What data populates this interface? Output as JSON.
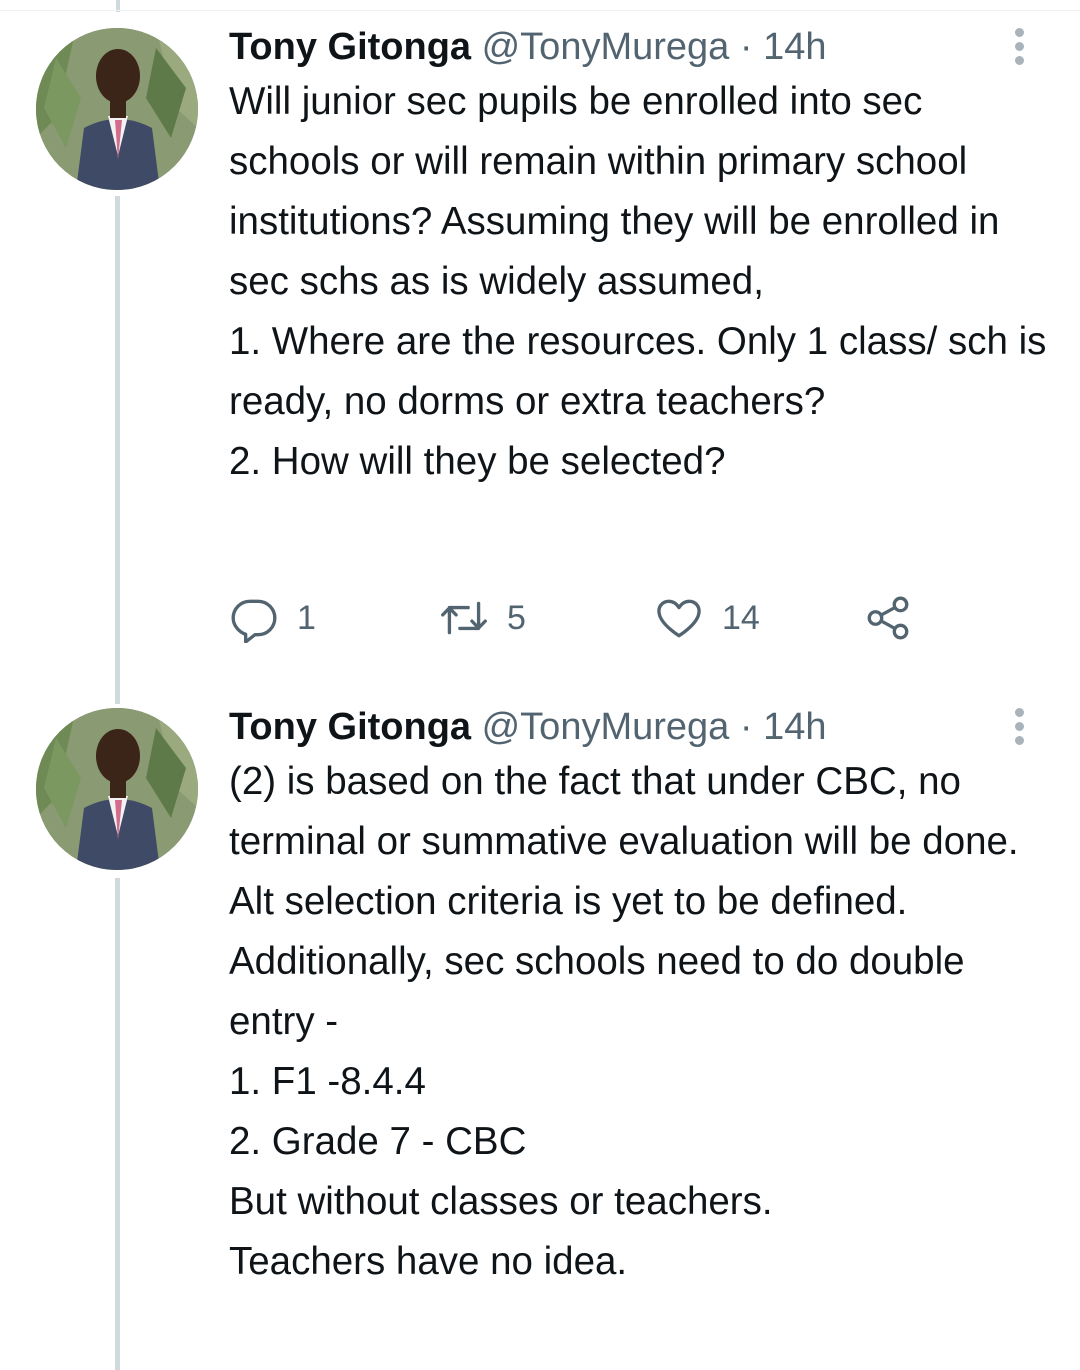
{
  "tweets": [
    {
      "author_name": "Tony Gitonga",
      "handle": "@TonyMurega",
      "separator": "·",
      "time": "14h",
      "text": "Will junior sec pupils be enrolled into sec schools or will remain within primary school institutions? Assuming they will be enrolled in sec schs as is widely assumed,\n1. Where are the resources. Only 1 class/ sch is ready, no dorms or extra teachers?\n2. How will they be selected?",
      "replies": "1",
      "retweets": "5",
      "likes": "14"
    },
    {
      "author_name": "Tony Gitonga",
      "handle": "@TonyMurega",
      "separator": "·",
      "time": "14h",
      "text": "(2) is based on the fact that under CBC, no terminal or summative evaluation will be done. Alt selection criteria is yet to be defined.\nAdditionally, sec schools need to do double entry -\n1. F1 -8.4.4\n2. Grade 7 - CBC\nBut without classes or teachers.\nTeachers have no idea."
    }
  ],
  "icons": {
    "reply": "reply-icon",
    "retweet": "retweet-icon",
    "like": "heart-icon",
    "share": "share-icon",
    "more": "more-vertical-icon",
    "avatar": "avatar-photo"
  },
  "colors": {
    "text": "#0f1419",
    "secondary": "#536471",
    "thread_line": "#cfd9de"
  }
}
